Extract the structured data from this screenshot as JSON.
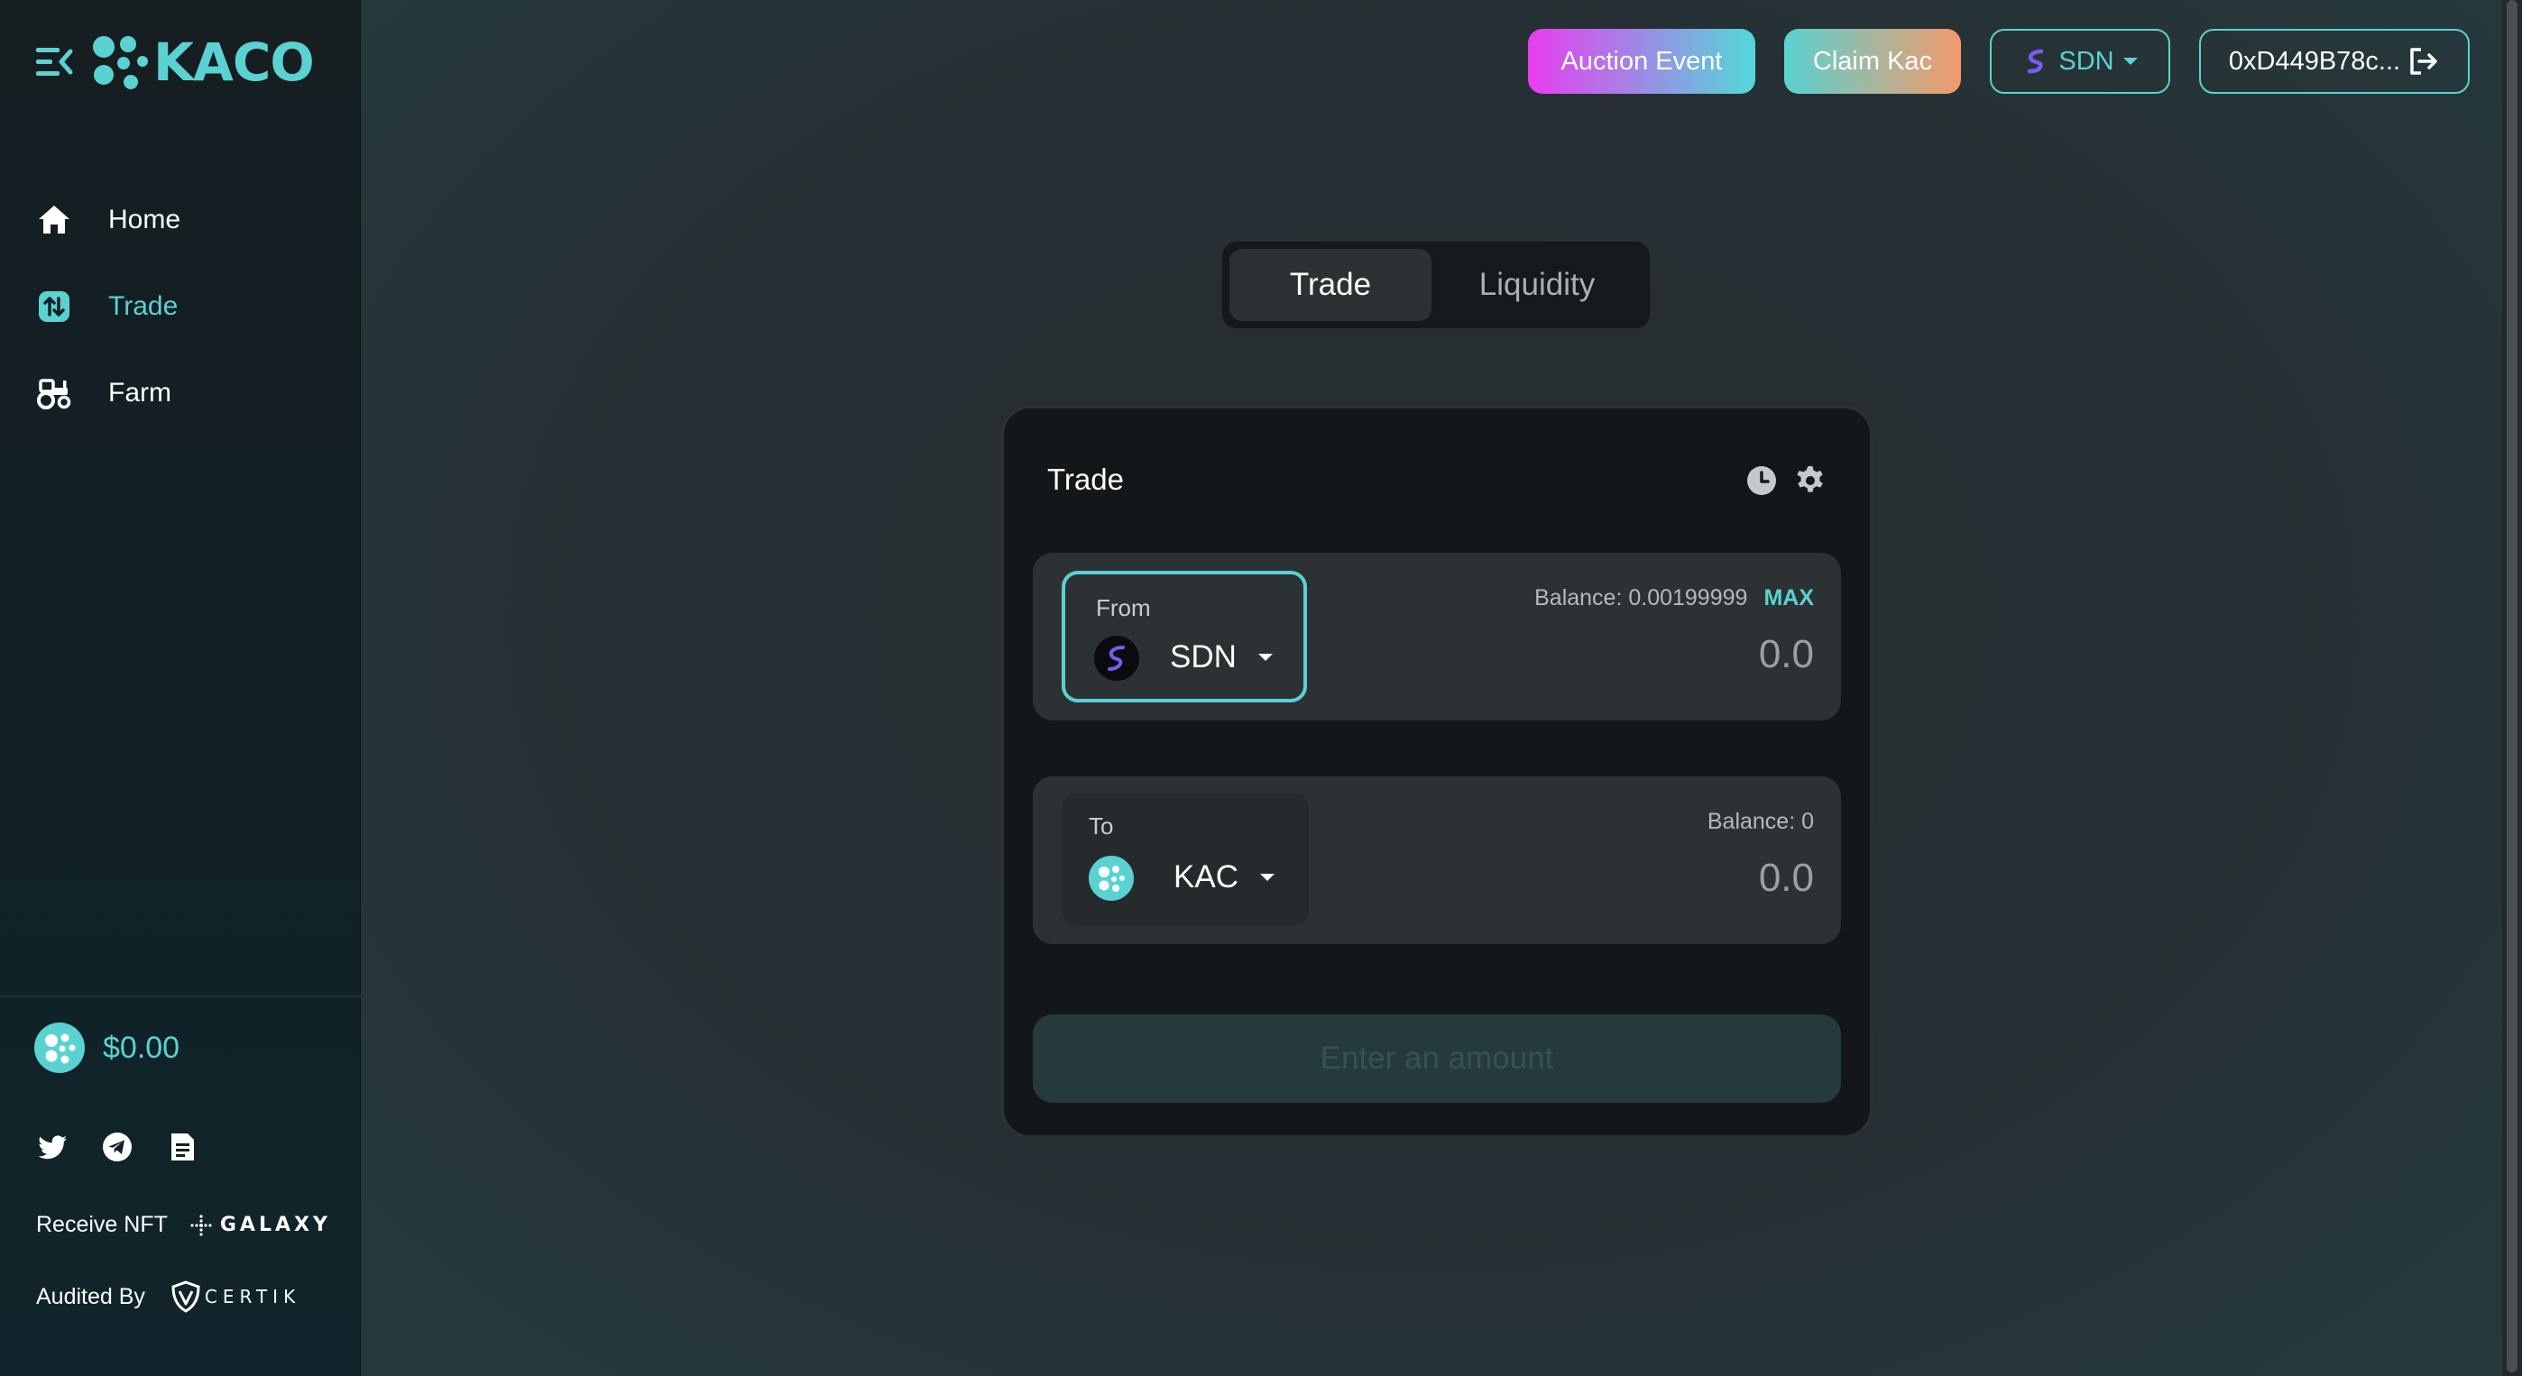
{
  "brand": {
    "name": "KACO"
  },
  "sidebar": {
    "items": [
      {
        "label": "Home",
        "icon": "home-icon"
      },
      {
        "label": "Trade",
        "icon": "trade-icon",
        "active": true
      },
      {
        "label": "Farm",
        "icon": "tractor-icon"
      }
    ],
    "price": "$0.00",
    "socials": [
      "twitter-icon",
      "telegram-icon",
      "document-icon"
    ],
    "receive_nft_label": "Receive NFT",
    "galaxy_text": "GALAXY",
    "audited_by_label": "Audited By",
    "certik_text": "CERTIK"
  },
  "header": {
    "auction_label": "Auction Event",
    "claim_label": "Claim Kac",
    "network_label": "SDN",
    "wallet_label": "0xD449B78c..."
  },
  "tabs": [
    {
      "label": "Trade",
      "active": true
    },
    {
      "label": "Liquidity",
      "active": false
    }
  ],
  "trade": {
    "title": "Trade",
    "from": {
      "label": "From",
      "symbol": "SDN",
      "balance": "Balance: 0.00199999",
      "max_label": "MAX",
      "amount_placeholder": "0.0"
    },
    "to": {
      "label": "To",
      "symbol": "KAC",
      "balance": "Balance: 0",
      "amount_placeholder": "0.0"
    },
    "submit_label": "Enter an amount"
  },
  "colors": {
    "accent": "#5ad2d2",
    "background": "#252b2e",
    "card": "#131719",
    "panel": "#2c3134",
    "auction_gradient_start": "#e83df0",
    "claim_gradient_end": "#f39a6b"
  }
}
